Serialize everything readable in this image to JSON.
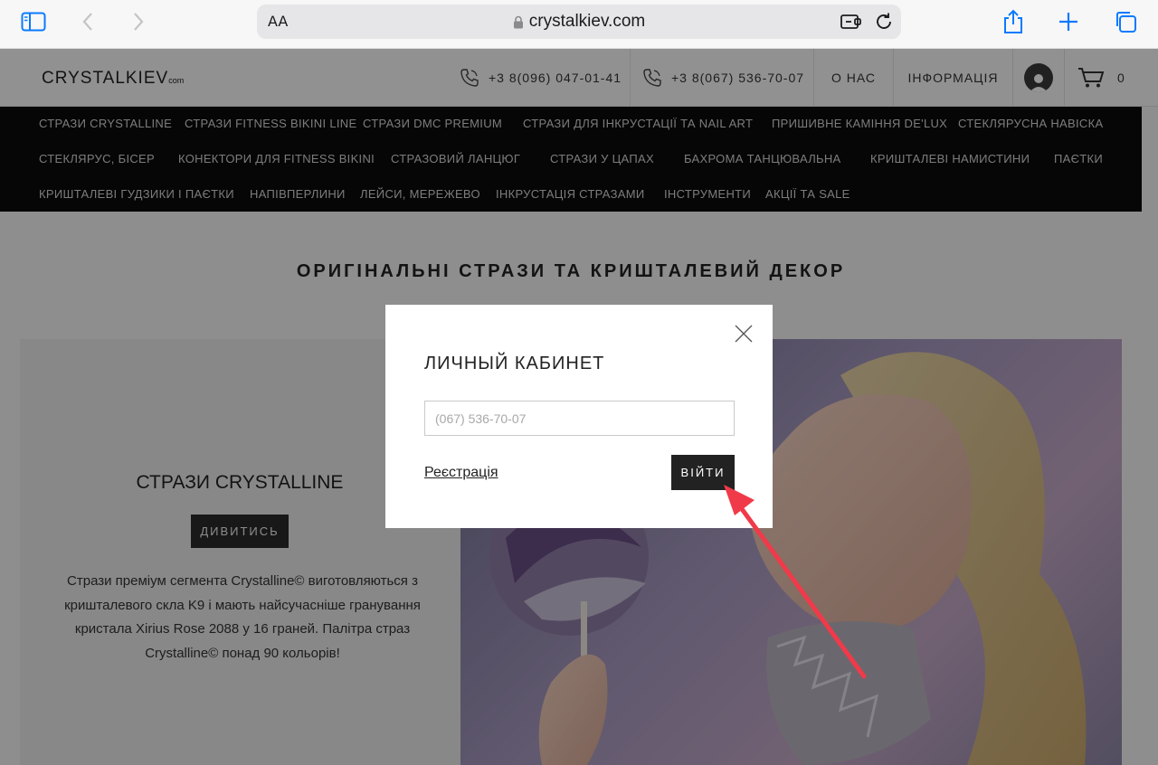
{
  "browser": {
    "url": "crystalkiev.com",
    "text_size_label": "AA"
  },
  "header": {
    "logo_main": "CRYSTALKIEV",
    "logo_suffix": "com",
    "phone_1": "+3 8(096) 047-01-41",
    "phone_2": "+3 8(067) 536-70-07",
    "about": "О НАС",
    "info": "ІНФОРМАЦІЯ",
    "cart_count": "0"
  },
  "categories": [
    "СТРАЗИ CRYSTALLINE",
    "СТРАЗИ FITNESS BIKINI LINE",
    "СТРАЗИ DMC PREMIUM",
    "СТРАЗИ ДЛЯ ІНКРУСТАЦІЇ ТА NAIL ART",
    "ПРИШИВНЕ КАМІННЯ DE'LUX",
    "СТЕКЛЯРУСНА НАВІСКА",
    "СТЕКЛЯРУС, БІСЕР",
    "КОНЕКТОРИ ДЛЯ FITNESS BIKINI",
    "СТРАЗОВИЙ ЛАНЦЮГ",
    "СТРАЗИ У ЦАПАХ",
    "БАХРОМА ТАНЦЮВАЛЬНА",
    "КРИШТАЛЕВІ НАМИСТИНИ",
    "ПАЄТКИ",
    "КРИШТАЛЕВІ ГУДЗИКИ І ПАЄТКИ",
    "НАПІВПЕРЛИНИ",
    "ЛЕЙСИ, МЕРЕЖЕВО",
    "ІНКРУСТАЦІЯ СТРАЗАМИ",
    "ІНСТРУМЕНТИ",
    "АКЦІЇ ТА SALE"
  ],
  "main": {
    "title": "ОРИГІНАЛЬНІ СТРАЗИ ТА КРИШТАЛЕВИЙ ДЕКОР",
    "promo_title": "СТРАЗИ CRYSTALLINE",
    "promo_button": "ДИВИТИСЬ",
    "promo_description": "Стрази преміум сегмента Crystalline© виготовляються з кришталевого скла K9 і мають найсучасніше гранування кристала Xirius Rose 2088 у 16 граней. Палітра страз Crystalline© понад 90 кольорів!"
  },
  "modal": {
    "title": "ЛИЧНЫЙ КАБИНЕТ",
    "phone_placeholder": "(067) 536-70-07",
    "register_link": "Реєстрація",
    "login_button": "ВІЙТИ"
  },
  "colors": {
    "nav_background": "#0b0b0b",
    "button_dark": "#222222",
    "browser_accent": "#0a7aff",
    "annotation_arrow": "#f03a4a"
  }
}
